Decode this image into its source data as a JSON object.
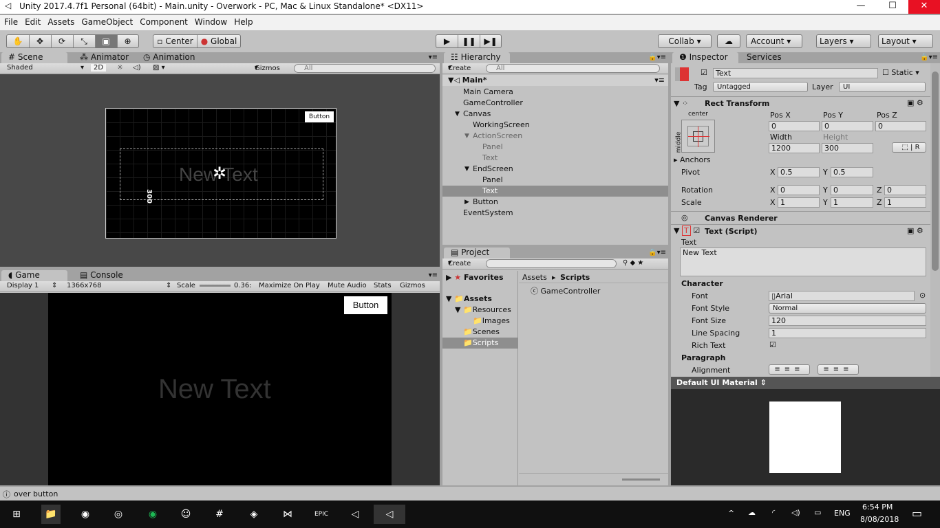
{
  "window": {
    "title": "Unity 2017.4.7f1 Personal (64bit) - Main.unity - Overwork - PC, Mac & Linux Standalone* <DX11>",
    "minimize": "—",
    "maximize": "☐",
    "close": "✕"
  },
  "menu": [
    "File",
    "Edit",
    "Assets",
    "GameObject",
    "Component",
    "Window",
    "Help"
  ],
  "toolbar": {
    "center": "Center",
    "global": "Global",
    "collab": "Collab ▾",
    "account": "Account",
    "layers": "Layers",
    "layout": "Layout"
  },
  "scene": {
    "tabs": [
      "Scene",
      "Animator",
      "Animation"
    ],
    "shading": "Shaded",
    "mode2d": "2D",
    "gizmos": "Gizmos",
    "search_placeholder": "All",
    "button_label": "Button",
    "text": "New Text",
    "height_label": "300"
  },
  "game": {
    "tabs": [
      "Game",
      "Console"
    ],
    "display": "Display 1",
    "resolution": "1366x768",
    "scale_label": "Scale",
    "scale_value": "0.36:",
    "maximize": "Maximize On Play",
    "mute": "Mute Audio",
    "stats": "Stats",
    "gizmos": "Gizmos",
    "button_label": "Button",
    "text": "New Text"
  },
  "hierarchy": {
    "tab": "Hierarchy",
    "create": "Create",
    "search_placeholder": "All",
    "scene": "Main*",
    "items": [
      {
        "label": "Main Camera",
        "depth": 0,
        "arrow": ""
      },
      {
        "label": "GameController",
        "depth": 0,
        "arrow": ""
      },
      {
        "label": "Canvas",
        "depth": 0,
        "arrow": "▼"
      },
      {
        "label": "WorkingScreen",
        "depth": 1,
        "arrow": ""
      },
      {
        "label": "ActionScreen",
        "depth": 1,
        "arrow": "▼",
        "dim": true
      },
      {
        "label": "Panel",
        "depth": 2,
        "arrow": "",
        "dim": true
      },
      {
        "label": "Text",
        "depth": 2,
        "arrow": "",
        "dim": true
      },
      {
        "label": "EndScreen",
        "depth": 1,
        "arrow": "▼"
      },
      {
        "label": "Panel",
        "depth": 2,
        "arrow": ""
      },
      {
        "label": "Text",
        "depth": 2,
        "arrow": "",
        "selected": true
      },
      {
        "label": "Button",
        "depth": 1,
        "arrow": "▶"
      },
      {
        "label": "EventSystem",
        "depth": 0,
        "arrow": ""
      }
    ]
  },
  "project": {
    "tab": "Project",
    "create": "Create",
    "favorites": "Favorites",
    "assets": "Assets",
    "resources": "Resources",
    "images": "Images",
    "scenes": "Scenes",
    "scripts": "Scripts",
    "breadcrumb_root": "Assets",
    "breadcrumb_leaf": "Scripts",
    "file": "GameController"
  },
  "inspector": {
    "tabs": [
      "Inspector",
      "Services"
    ],
    "name": "Text",
    "static": "Static",
    "tag_label": "Tag",
    "tag": "Untagged",
    "layer_label": "Layer",
    "layer": "UI",
    "rect": {
      "title": "Rect Transform",
      "anchor_h": "center",
      "anchor_v": "middle",
      "posx_label": "Pos X",
      "posy_label": "Pos Y",
      "posz_label": "Pos Z",
      "posx": "0",
      "posy": "0",
      "posz": "0",
      "width_label": "Width",
      "height_label": "Height",
      "width": "1200",
      "height": "300",
      "r": "R",
      "anchors": "Anchors",
      "pivot": "Pivot",
      "pivot_x": "0.5",
      "pivot_y": "0.5",
      "rotation": "Rotation",
      "rot_x": "0",
      "rot_y": "0",
      "rot_z": "0",
      "scale": "Scale",
      "scale_x": "1",
      "scale_y": "1",
      "scale_z": "1",
      "x": "X",
      "y": "Y",
      "z": "Z"
    },
    "canvas_renderer": "Canvas Renderer",
    "text_script": {
      "title": "Text (Script)",
      "text_label": "Text",
      "text_value": "New Text",
      "character": "Character",
      "font_label": "Font",
      "font": "Arial",
      "font_style_label": "Font Style",
      "font_style": "Normal",
      "font_size_label": "Font Size",
      "font_size": "120",
      "line_spacing_label": "Line Spacing",
      "line_spacing": "1",
      "rich_text_label": "Rich Text",
      "paragraph": "Paragraph",
      "alignment_label": "Alignment"
    },
    "material": "Default UI Material"
  },
  "status": "over button",
  "taskbar": {
    "lang": "ENG",
    "time": "6:54 PM",
    "date": "8/08/2018"
  }
}
